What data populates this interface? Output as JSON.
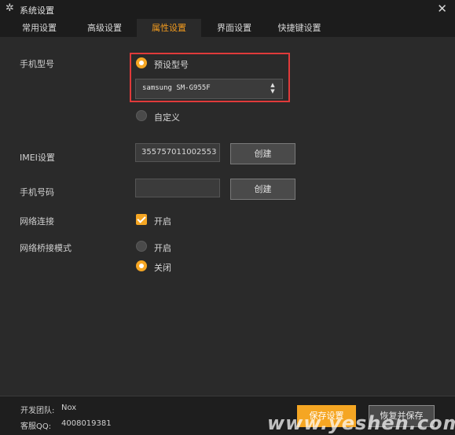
{
  "window": {
    "title": "系统设置",
    "close_label": "✕"
  },
  "tabs": [
    {
      "label": "常用设置"
    },
    {
      "label": "高级设置"
    },
    {
      "label": "属性设置",
      "active": true
    },
    {
      "label": "界面设置"
    },
    {
      "label": "快捷键设置"
    }
  ],
  "phone_model": {
    "label": "手机型号",
    "preset_label": "预设型号",
    "preset_selected": true,
    "preset_value": "samsung SM-G955F",
    "custom_label": "自定义",
    "custom_selected": false
  },
  "imei": {
    "label": "IMEI设置",
    "value": "355757011002553",
    "button_label": "创建"
  },
  "phone_number": {
    "label": "手机号码",
    "value": "",
    "button_label": "创建"
  },
  "network": {
    "label": "网络连接",
    "checkbox_label": "开启",
    "checked": true
  },
  "bridge_mode": {
    "label": "网络桥接模式",
    "options": [
      {
        "label": "开启",
        "selected": false
      },
      {
        "label": "关闭",
        "selected": true
      }
    ]
  },
  "footer": {
    "team_label": "开发团队:",
    "team_value": "Nox",
    "qq_label": "客服QQ:",
    "qq_value": "4008019381",
    "save_label": "保存设置",
    "reset_label": "恢复并保存"
  },
  "watermark": "www.yeshen.com",
  "colors": {
    "accent": "#f5a623",
    "highlight_box": "#e03a3a",
    "background": "#2a2a2a",
    "titlebar": "#1c1c1c"
  }
}
